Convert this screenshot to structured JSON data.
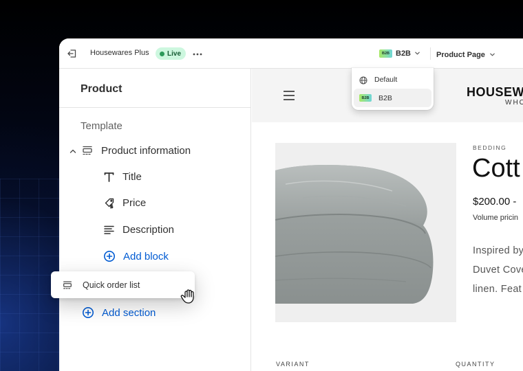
{
  "topbar": {
    "store_name": "Housewares Plus",
    "status": "Live",
    "context_chip": "B2B",
    "context_label": "B2B",
    "page_label": "Product Page"
  },
  "context_dropdown": {
    "items": [
      {
        "label": "Default",
        "icon": "globe-icon"
      },
      {
        "label": "B2B",
        "chip": "B2B",
        "selected": true
      }
    ]
  },
  "sidebar": {
    "title": "Product",
    "template_label": "Template",
    "section": {
      "label": "Product information",
      "expanded": true
    },
    "blocks": [
      {
        "label": "Title",
        "icon": "text-icon"
      },
      {
        "label": "Price",
        "icon": "price-tag-icon"
      },
      {
        "label": "Description",
        "icon": "paragraph-icon"
      }
    ],
    "add_block": "Add block",
    "add_section": "Add section"
  },
  "drag_card": {
    "label": "Quick order list",
    "icon": "section-icon"
  },
  "preview": {
    "brand": "HOUSEW",
    "brand_sub": "WHO",
    "category": "BEDDING",
    "product_title": "Cott",
    "price": "$200.00 -",
    "volume": "Volume pricin",
    "description_lines": [
      "Inspired by",
      "Duvet Cove",
      "linen. Feat"
    ],
    "variant_header": "VARIANT",
    "quantity_header": "QUANTITY"
  },
  "colors": {
    "accent_blue": "#005bd3",
    "live_badge_bg": "#cdf7df",
    "live_dot": "#2c9a5a"
  }
}
